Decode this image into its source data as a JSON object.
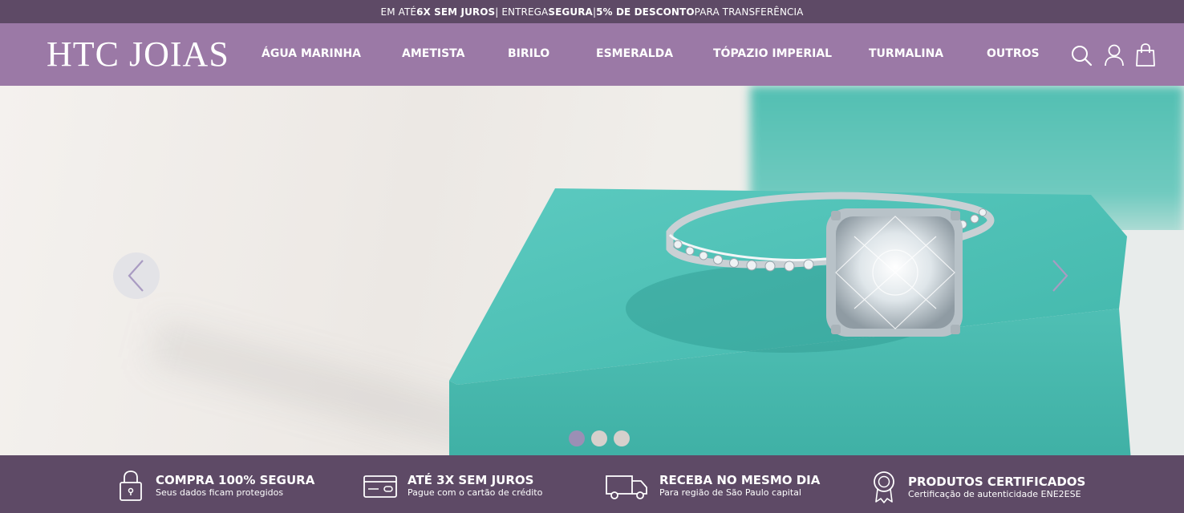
{
  "topbar": {
    "part1": "EM ATÉ ",
    "part2": "6X SEM JUROS",
    "part3": "| ENTREGA ",
    "part4": "SEGURA",
    "part5": " |",
    "part6": "5% DE DESCONTO",
    "part7": " PARA TRANSFERÊNCIA"
  },
  "header": {
    "logo": "HTC JOIAS",
    "nav": [
      "ÁGUA MARINHA",
      "AMETISTA",
      "BIRILO",
      "ESMERALDA",
      "TÓPAZIO IMPERIAL",
      "TURMALINA",
      "OUTROS"
    ],
    "icons": [
      "search-icon",
      "user-icon",
      "shopping-bag-icon"
    ]
  },
  "hero": {
    "slide_count": 3,
    "active_slide": 1
  },
  "features": [
    {
      "title": "COMPRA 100% SEGURA",
      "subtitle": "Seus dados ficam protegidos",
      "icon": "padlock-icon"
    },
    {
      "title": "ATÉ 3X SEM JUROS",
      "subtitle": "Pague com o cartão de crédito",
      "icon": "credit-card-icon"
    },
    {
      "title": "RECEBA NO MESMO DIA",
      "subtitle": "Para região de São Paulo capital",
      "icon": "delivery-truck-icon"
    },
    {
      "title": "PRODUTOS CERTIFICADOS",
      "subtitle": "Certificação de autenticidade ENE2ESE",
      "icon": "certificate-medal-icon"
    }
  ],
  "colors": {
    "topbar_bg": "#5e4a66",
    "header_bg": "#9b79a6",
    "footer_bg": "#5e4a66",
    "box_teal": "#57c2b8",
    "active_dot": "#9b8fb5"
  }
}
